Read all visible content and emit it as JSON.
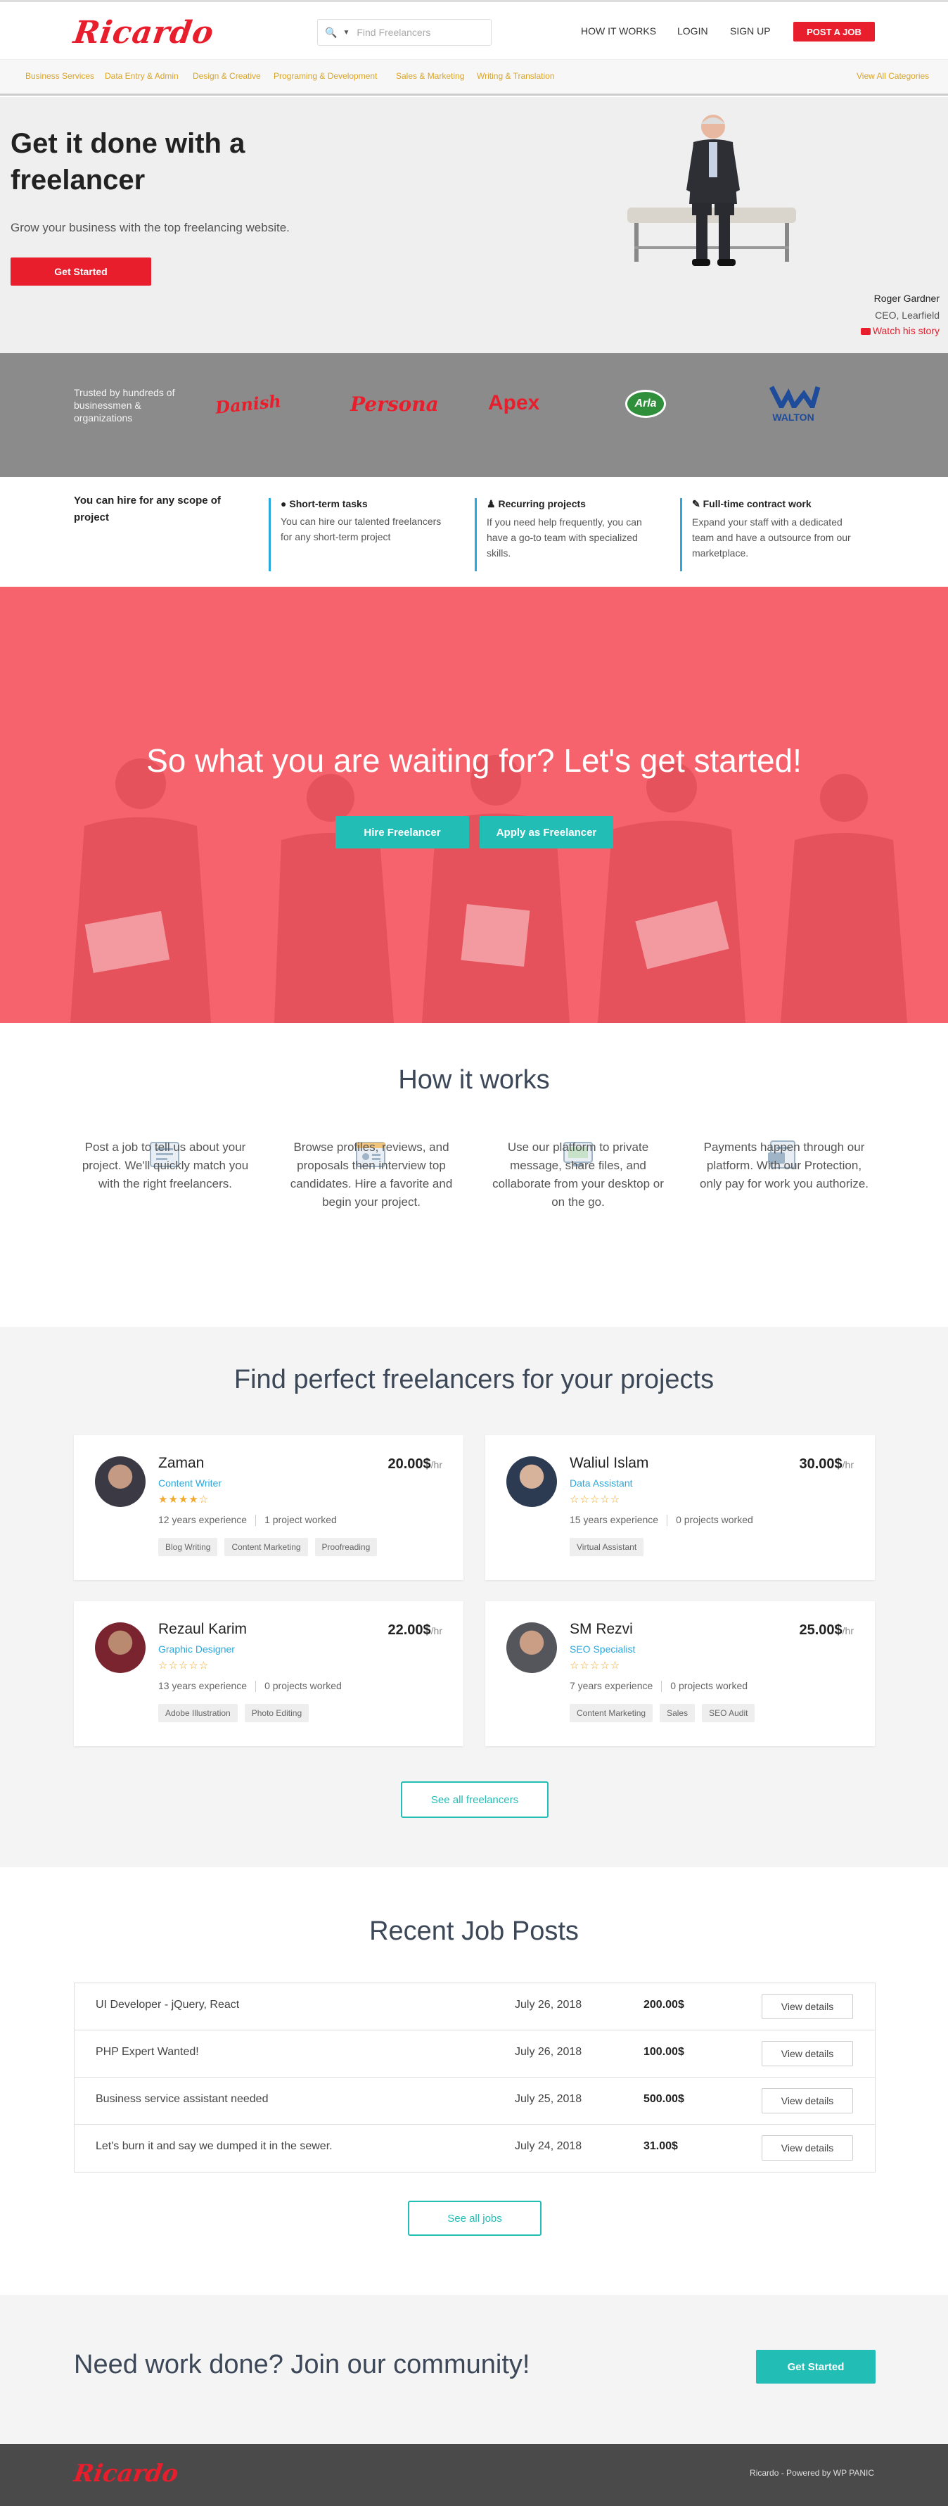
{
  "header": {
    "logo": "Ricardo",
    "search_placeholder": "Find Freelancers",
    "nav": [
      "HOW IT WORKS",
      "LOGIN",
      "SIGN UP"
    ],
    "post_job": "POST A JOB"
  },
  "categories": {
    "items": [
      "Business Services",
      "Data Entry & Admin",
      "Design & Creative",
      "Programing & Development",
      "Sales & Marketing",
      "Writing & Translation"
    ],
    "view_all": "View All Categories"
  },
  "hero": {
    "title": "Get it done with a freelancer",
    "subtitle": "Grow your business with the top freelancing website.",
    "button": "Get Started",
    "person_name": "Roger Gardner",
    "person_role": "CEO, Learfield",
    "watch": "Watch his story"
  },
  "trusted": {
    "text": "Trusted by hundreds of businessmen & organizations",
    "brands": [
      "Danish",
      "Persona",
      "Apex",
      "Arla",
      "WALTON"
    ]
  },
  "scopes": {
    "lead": "You can hire for any scope of project",
    "items": [
      {
        "title": "Short-term tasks",
        "desc": "You can hire our talented freelancers for any short-term project"
      },
      {
        "title": "Recurring projects",
        "desc": "If you need help frequently, you can have a go-to team with specialized skills."
      },
      {
        "title": "Full-time contract work",
        "desc": "Expand your staff with a dedicated team and have a outsource from our marketplace."
      }
    ]
  },
  "cta": {
    "title": "So what you are waiting for? Let's get started!",
    "hire": "Hire Freelancer",
    "apply": "Apply as Freelancer"
  },
  "how": {
    "title": "How it works",
    "items": [
      "Post a job to tell us about your project. We'll quickly match you with the right freelancers.",
      "Browse profiles, reviews, and proposals then interview top candidates. Hire a favorite and begin your project.",
      "Use our platform to private message, share files, and collaborate from your desktop or on the go.",
      "Payments happen through our platform. With our Protection, only pay for work you authorize."
    ]
  },
  "freelancers": {
    "title": "Find perfect freelancers for your projects",
    "items": [
      {
        "name": "Zaman",
        "role": "Content Writer",
        "rate": "20.00$",
        "unit": "/hr",
        "rating": 4.5,
        "experience": "12 years experience",
        "projects": "1 project worked",
        "tags": [
          "Blog Writing",
          "Content Marketing",
          "Proofreading"
        ]
      },
      {
        "name": "Waliul Islam",
        "role": "Data Assistant",
        "rate": "30.00$",
        "unit": "/hr",
        "rating": 0,
        "experience": "15 years experience",
        "projects": "0 projects worked",
        "tags": [
          "Virtual Assistant"
        ]
      },
      {
        "name": "Rezaul Karim",
        "role": "Graphic Designer",
        "rate": "22.00$",
        "unit": "/hr",
        "rating": 0,
        "experience": "13 years experience",
        "projects": "0 projects worked",
        "tags": [
          "Adobe Illustration",
          "Photo Editing"
        ]
      },
      {
        "name": "SM Rezvi",
        "role": "SEO Specialist",
        "rate": "25.00$",
        "unit": "/hr",
        "rating": 0,
        "experience": "7 years experience",
        "projects": "0 projects worked",
        "tags": [
          "Content Marketing",
          "Sales",
          "SEO Audit"
        ]
      }
    ],
    "see_all": "See all freelancers"
  },
  "jobs": {
    "title": "Recent Job Posts",
    "items": [
      {
        "title": "UI Developer - jQuery, React",
        "date": "July 26, 2018",
        "price": "200.00$",
        "action": "View details"
      },
      {
        "title": "PHP Expert Wanted!",
        "date": "July 26, 2018",
        "price": "100.00$",
        "action": "View details"
      },
      {
        "title": "Business service assistant needed",
        "date": "July 25, 2018",
        "price": "500.00$",
        "action": "View details"
      },
      {
        "title": "Let's burn it and say we dumped it in the sewer.",
        "date": "July 24, 2018",
        "price": "31.00$",
        "action": "View details"
      }
    ],
    "see_all": "See all jobs"
  },
  "join": {
    "title": "Need work done? Join our community!",
    "button": "Get Started"
  },
  "footer": {
    "logo": "Ricardo",
    "text": "Ricardo - Powered by WP PANIC"
  },
  "colors": {
    "brand_red": "#e91e2d",
    "teal": "#22bdb5",
    "cta_overlay": "#f7636d",
    "accent_blue": "#29a8dd",
    "category_gold": "#d9a42a"
  }
}
